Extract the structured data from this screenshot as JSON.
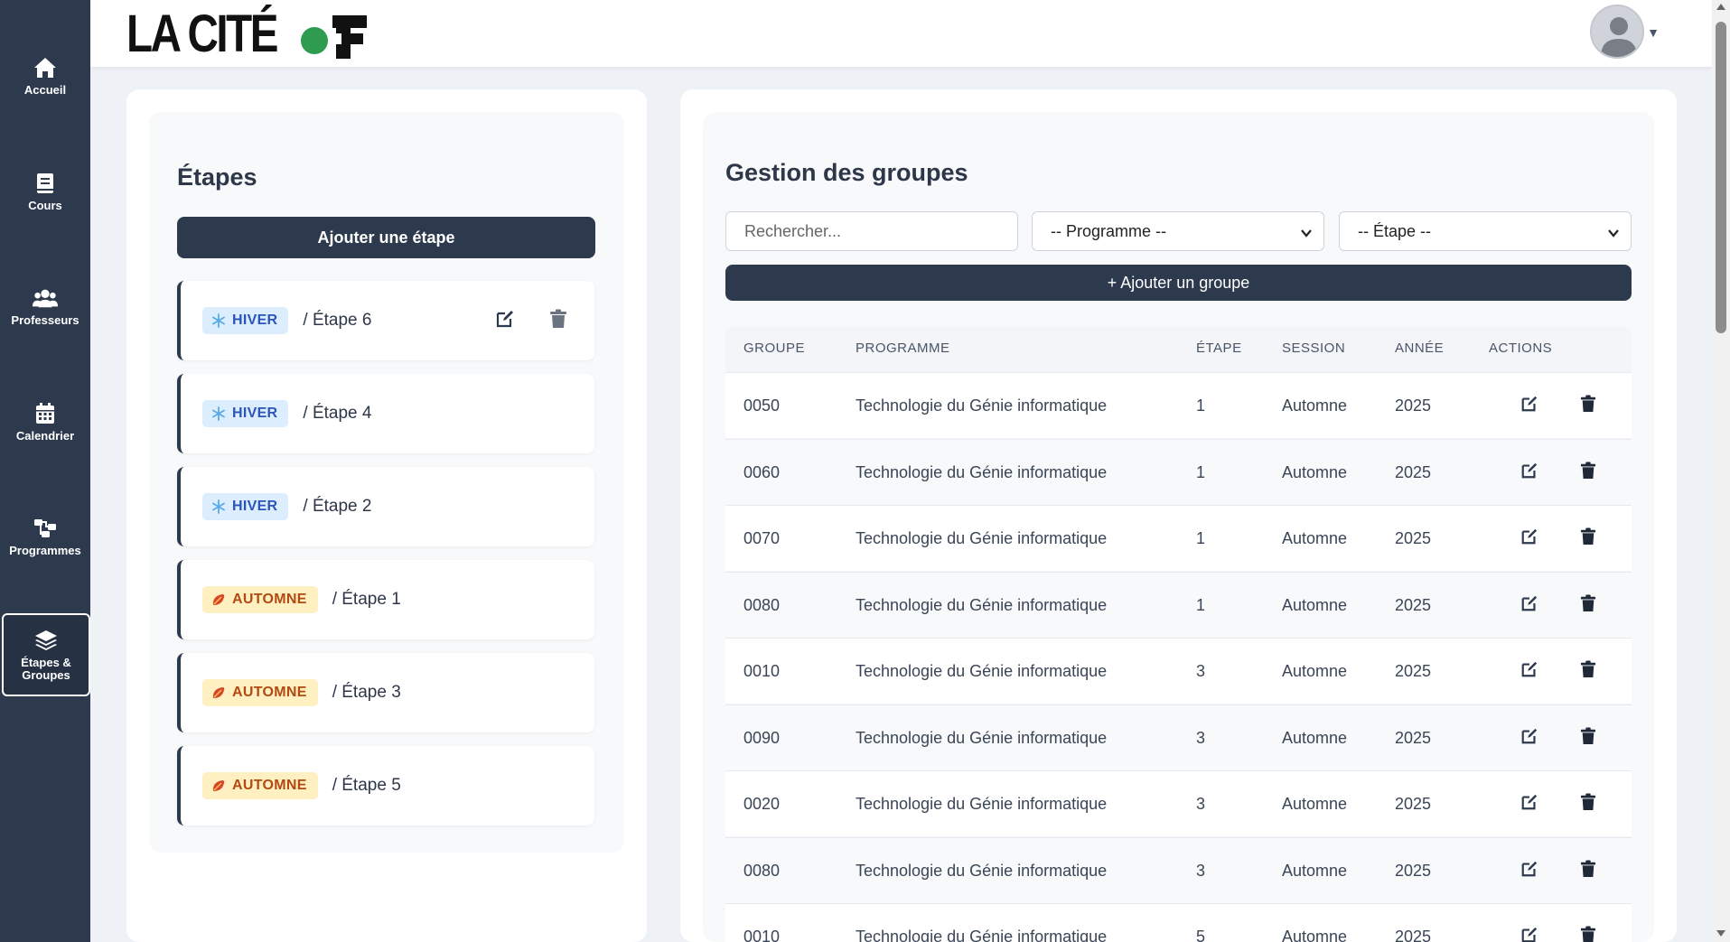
{
  "brand": {
    "logo_text": "LA CITÉ"
  },
  "colors": {
    "sidebar": "#2d3a4e",
    "accent_green": "#2e9b4f",
    "hiver_badge": "#dceefd",
    "automne_badge": "#fff0c2"
  },
  "sidebar": {
    "items": [
      {
        "label": "Accueil",
        "icon": "home-icon"
      },
      {
        "label": "Cours",
        "icon": "book-icon"
      },
      {
        "label": "Professeurs",
        "icon": "users-icon"
      },
      {
        "label": "Calendrier",
        "icon": "calendar-icon"
      },
      {
        "label": "Programmes",
        "icon": "sitemap-icon"
      },
      {
        "label_line1": "Étapes &",
        "label_line2": "Groupes",
        "icon": "layers-icon",
        "active": true
      }
    ]
  },
  "etapes_panel": {
    "title": "Étapes",
    "add_button": "Ajouter une étape",
    "items": [
      {
        "season": "HIVER",
        "name": "/ Étape 6"
      },
      {
        "season": "HIVER",
        "name": "/ Étape 4"
      },
      {
        "season": "HIVER",
        "name": "/ Étape 2"
      },
      {
        "season": "AUTOMNE",
        "name": "/ Étape 1"
      },
      {
        "season": "AUTOMNE",
        "name": "/ Étape 3"
      },
      {
        "season": "AUTOMNE",
        "name": "/ Étape 5"
      }
    ]
  },
  "groupes_panel": {
    "title": "Gestion des groupes",
    "search_placeholder": "Rechercher...",
    "programme_select": "-- Programme --",
    "etape_select": "-- Étape --",
    "add_button": "+ Ajouter un groupe",
    "columns": [
      "GROUPE",
      "PROGRAMME",
      "ÉTAPE",
      "SESSION",
      "ANNÉE",
      "ACTIONS"
    ],
    "rows": [
      {
        "groupe": "0050",
        "programme": "Technologie du Génie informatique",
        "etape": "1",
        "session": "Automne",
        "annee": "2025"
      },
      {
        "groupe": "0060",
        "programme": "Technologie du Génie informatique",
        "etape": "1",
        "session": "Automne",
        "annee": "2025"
      },
      {
        "groupe": "0070",
        "programme": "Technologie du Génie informatique",
        "etape": "1",
        "session": "Automne",
        "annee": "2025"
      },
      {
        "groupe": "0080",
        "programme": "Technologie du Génie informatique",
        "etape": "1",
        "session": "Automne",
        "annee": "2025"
      },
      {
        "groupe": "0010",
        "programme": "Technologie du Génie informatique",
        "etape": "3",
        "session": "Automne",
        "annee": "2025"
      },
      {
        "groupe": "0090",
        "programme": "Technologie du Génie informatique",
        "etape": "3",
        "session": "Automne",
        "annee": "2025"
      },
      {
        "groupe": "0020",
        "programme": "Technologie du Génie informatique",
        "etape": "3",
        "session": "Automne",
        "annee": "2025"
      },
      {
        "groupe": "0080",
        "programme": "Technologie du Génie informatique",
        "etape": "3",
        "session": "Automne",
        "annee": "2025"
      },
      {
        "groupe": "0010",
        "programme": "Technologie du Génie informatique",
        "etape": "5",
        "session": "Automne",
        "annee": "2025"
      }
    ]
  }
}
